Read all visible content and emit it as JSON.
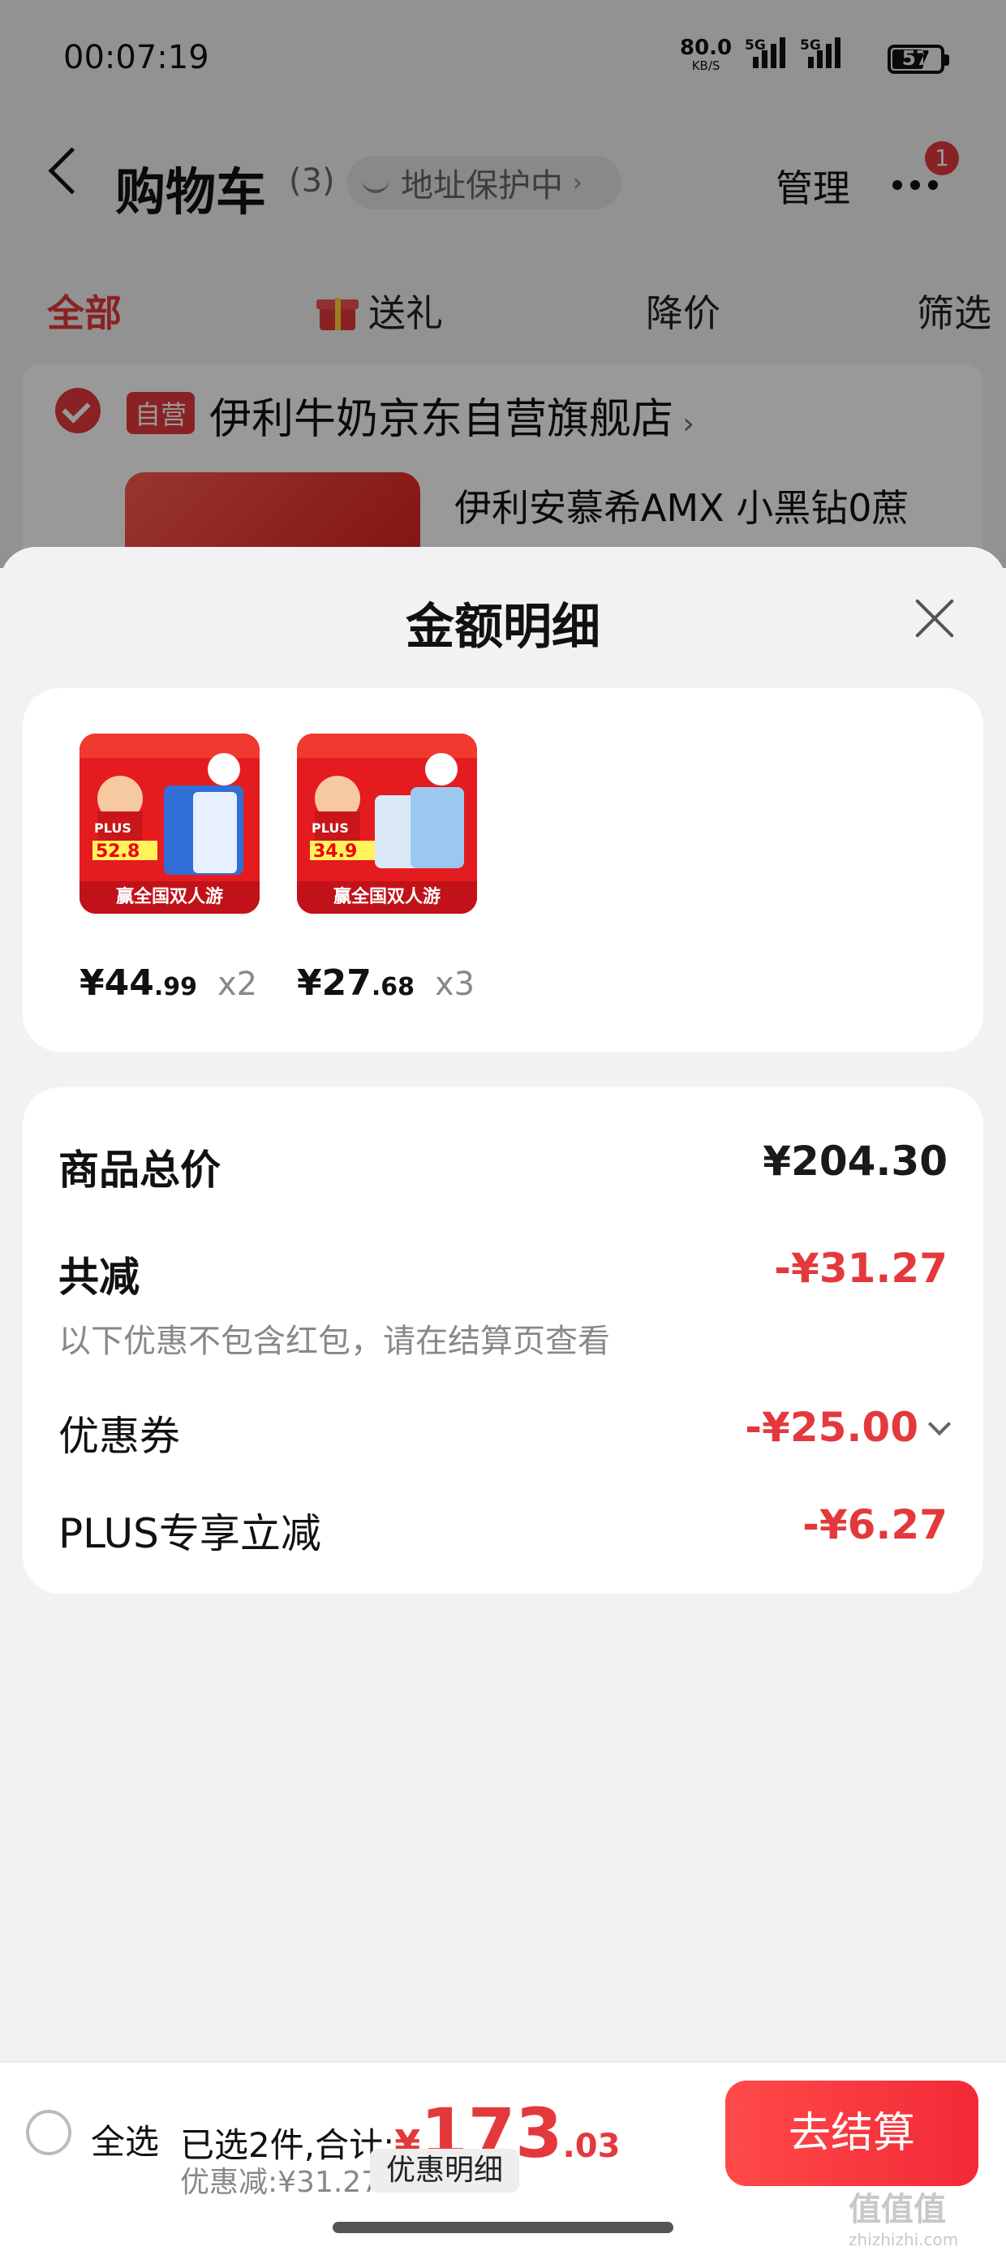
{
  "status_bar": {
    "time": "00:07:19",
    "net_speed": "80.0",
    "net_unit": "KB/S",
    "signal1": "5G",
    "signal2": "5G",
    "battery": "57"
  },
  "cart_header": {
    "title": "购物车",
    "count": "(3)",
    "address_protect": "地址保护中",
    "manage": "管理",
    "badge": "1"
  },
  "tabs": [
    "全部",
    "送礼",
    "降价",
    "筛选"
  ],
  "store": {
    "tag": "自营",
    "name": "伊利牛奶京东自营旗舰店",
    "product_title": "伊利安慕希AMX 小黑钻0蔗"
  },
  "sheet": {
    "title": "金额明细",
    "items": [
      {
        "price_int": "¥44",
        "price_dec": ".99",
        "qty": "x2",
        "promo_price": "52.8"
      },
      {
        "price_int": "¥27",
        "price_dec": ".68",
        "qty": "x3",
        "promo_price": "34.9"
      }
    ],
    "thumb_texts": {
      "plus": "PLUS",
      "bottom": "赢全国双人游"
    },
    "total_label": "商品总价",
    "total_value": "¥204.30",
    "discount_label": "共减",
    "discount_value": "-¥31.27",
    "discount_note": "以下优惠不包含红包，请在结算页查看",
    "coupon_label": "优惠券",
    "coupon_value": "-¥25.00",
    "plus_label": "PLUS专享立减",
    "plus_value": "-¥6.27"
  },
  "bottom_bar": {
    "select_all": "全选",
    "summary_prefix": "已选2件,合计:",
    "total_symbol": "¥",
    "total_int": "173",
    "total_dec": ".03",
    "saved": "优惠减:¥31.27",
    "detail_button": "优惠明细",
    "checkout": "去结算"
  },
  "watermark": {
    "main": "值值值",
    "sub": "zhizhizhi.com"
  },
  "colors": {
    "accent": "#e4393c",
    "checkout": "#f22a36"
  }
}
